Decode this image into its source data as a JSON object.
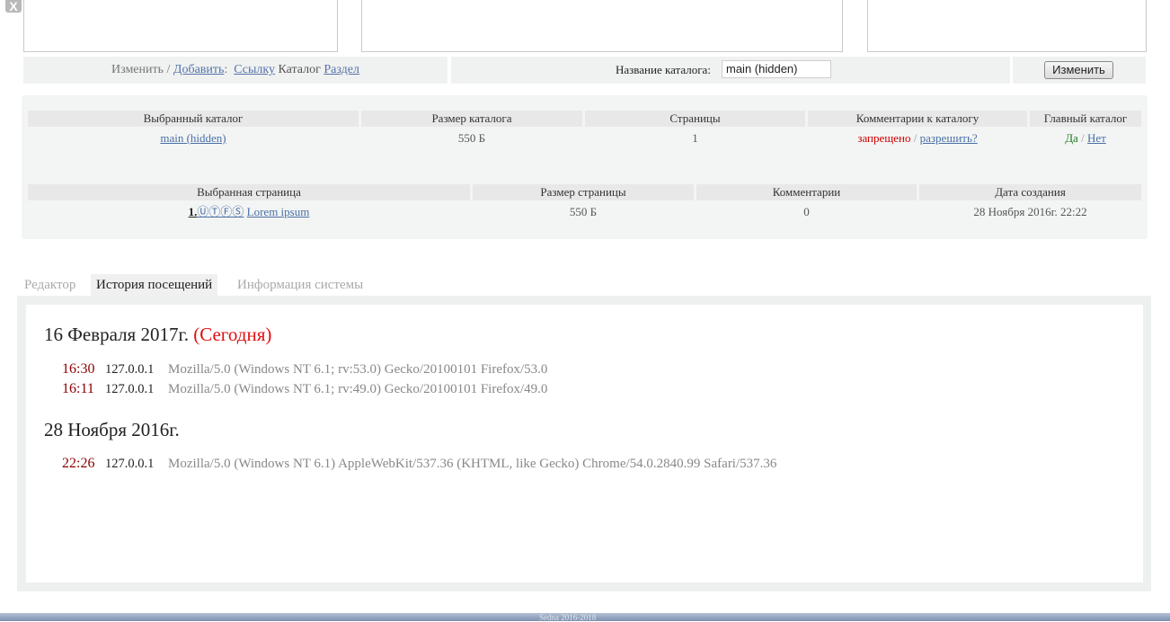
{
  "window": {
    "close_glyph": "X"
  },
  "toolbar": {
    "change_prefix": "Изменить",
    "slash": "/",
    "add_link": "Добавить",
    "colon": ":",
    "link_link": "Ссылку",
    "catalog_text": "Каталог",
    "section_link": "Раздел",
    "catalog_name_label": "Название каталога:",
    "catalog_name_value": "main (hidden)",
    "change_button": "Изменить"
  },
  "catalog_table": {
    "headers": [
      "Выбранный каталог",
      "Размер каталога",
      "Страницы",
      "Комментарии к каталогу",
      "Главный каталог"
    ],
    "selected_catalog": "main (hidden)",
    "size": "550 Б",
    "pages": "1",
    "comments_status": "запрещено",
    "comments_sep": "/",
    "comments_action": "разрешить?",
    "main_yes": "Да",
    "main_sep": "/",
    "main_no": "Нет"
  },
  "page_table": {
    "sort_icon": "↥",
    "headers": [
      "Выбранная страница",
      "Размер страницы",
      "Комментарии",
      "Дата создания"
    ],
    "page_index": "1.",
    "page_flags": "ⓊⓉⒻⓈ",
    "page_title": "Lorem ipsum",
    "size": "550 Б",
    "comments": "0",
    "created": "28 Ноября 2016г. 22:22"
  },
  "tabs": [
    {
      "label": "Редактор",
      "active": false
    },
    {
      "label": "История посещений",
      "active": true
    },
    {
      "label": "Информация системы",
      "active": false
    }
  ],
  "history": {
    "days": [
      {
        "date": "16 Февраля 2017г.",
        "badge": "(Сегодня)",
        "visits": [
          {
            "time": "16:30",
            "ip": "127.0.0.1",
            "ua": "Mozilla/5.0 (Windows NT 6.1; rv:53.0) Gecko/20100101 Firefox/53.0"
          },
          {
            "time": "16:11",
            "ip": "127.0.0.1",
            "ua": "Mozilla/5.0 (Windows NT 6.1; rv:49.0) Gecko/20100101 Firefox/49.0"
          }
        ]
      },
      {
        "date": "28 Ноября 2016г.",
        "badge": "",
        "visits": [
          {
            "time": "22:26",
            "ip": "127.0.0.1",
            "ua": "Mozilla/5.0 (Windows NT 6.1) AppleWebKit/537.36 (KHTML, like Gecko) Chrome/54.0.2840.99 Safari/537.36"
          }
        ]
      }
    ]
  },
  "footer": {
    "text": "Sedna 2016-2018"
  },
  "colors": {
    "link": "#4a6fa5",
    "forbidden": "#d10000",
    "yes": "#1d7a1d",
    "visit_time": "#8b0000",
    "today": "#e01010"
  }
}
